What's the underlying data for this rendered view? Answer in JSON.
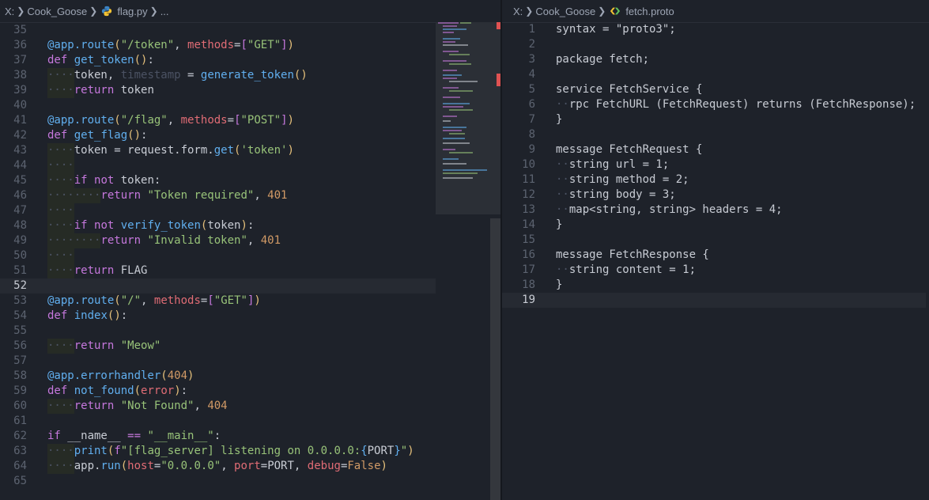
{
  "left_pane": {
    "breadcrumb": {
      "drive": "X:",
      "folder": "Cook_Goose",
      "file": "flag.py",
      "more": "..."
    },
    "active_line": 52,
    "lines": [
      {
        "n": "35",
        "html": ""
      },
      {
        "n": "36",
        "html": "<span class='dec'>@app.route</span><span class='p1'>(</span><span class='str'>\"/token\"</span>, <span class='param'>methods</span>=<span class='p2'>[</span><span class='str'>\"GET\"</span><span class='p2'>]</span><span class='p1'>)</span>"
      },
      {
        "n": "37",
        "html": "<span class='kw'>def</span> <span class='fn'>get_token</span><span class='p1'>()</span>:"
      },
      {
        "n": "38",
        "html": "<span class='ig'>····</span>token, <span class='gr'>timestamp</span> = <span class='fn'>generate_token</span><span class='p1'>()</span>"
      },
      {
        "n": "39",
        "html": "<span class='ig'>····</span><span class='kw'>return</span> token"
      },
      {
        "n": "40",
        "html": ""
      },
      {
        "n": "41",
        "html": "<span class='dec'>@app.route</span><span class='p1'>(</span><span class='str'>\"/flag\"</span>, <span class='param'>methods</span>=<span class='p2'>[</span><span class='str'>\"POST\"</span><span class='p2'>]</span><span class='p1'>)</span>"
      },
      {
        "n": "42",
        "html": "<span class='kw'>def</span> <span class='fn'>get_flag</span><span class='p1'>()</span>:"
      },
      {
        "n": "43",
        "html": "<span class='ig'>····</span>token = request.form.<span class='fn'>get</span><span class='p1'>(</span><span class='str'>'token'</span><span class='p1'>)</span>"
      },
      {
        "n": "44",
        "html": "<span class='ig'>····</span>"
      },
      {
        "n": "45",
        "html": "<span class='ig'>····</span><span class='kw'>if</span> <span class='kw'>not</span> token:"
      },
      {
        "n": "46",
        "html": "<span class='ig'>····</span><span class='ig'>····</span><span class='kw'>return</span> <span class='str'>\"Token required\"</span>, <span class='num'>401</span>"
      },
      {
        "n": "47",
        "html": "<span class='ig'>····</span>"
      },
      {
        "n": "48",
        "html": "<span class='ig'>····</span><span class='kw'>if</span> <span class='kw'>not</span> <span class='fn'>verify_token</span><span class='p1'>(</span>token<span class='p1'>)</span>:"
      },
      {
        "n": "49",
        "html": "<span class='ig'>····</span><span class='ig'>····</span><span class='kw'>return</span> <span class='str'>\"Invalid token\"</span>, <span class='num'>401</span>"
      },
      {
        "n": "50",
        "html": "<span class='ig'>····</span>"
      },
      {
        "n": "51",
        "html": "<span class='ig'>····</span><span class='kw'>return</span> FLAG"
      },
      {
        "n": "52",
        "html": ""
      },
      {
        "n": "53",
        "html": "<span class='dec'>@app.route</span><span class='p1'>(</span><span class='str'>\"/\"</span>, <span class='param'>methods</span>=<span class='p2'>[</span><span class='str'>\"GET\"</span><span class='p2'>]</span><span class='p1'>)</span>"
      },
      {
        "n": "54",
        "html": "<span class='kw'>def</span> <span class='fn'>index</span><span class='p1'>()</span>:"
      },
      {
        "n": "55",
        "html": ""
      },
      {
        "n": "56",
        "html": "<span class='ig'>····</span><span class='kw'>return</span> <span class='str'>\"Meow\"</span>"
      },
      {
        "n": "57",
        "html": ""
      },
      {
        "n": "58",
        "html": "<span class='dec'>@app.errorhandler</span><span class='p1'>(</span><span class='num'>404</span><span class='p1'>)</span>"
      },
      {
        "n": "59",
        "html": "<span class='kw'>def</span> <span class='fn'>not_found</span><span class='p1'>(</span><span class='param'>error</span><span class='p1'>)</span>:"
      },
      {
        "n": "60",
        "html": "<span class='ig'>····</span><span class='kw'>return</span> <span class='str'>\"Not Found\"</span>, <span class='num'>404</span>"
      },
      {
        "n": "61",
        "html": ""
      },
      {
        "n": "62",
        "html": "<span class='kw'>if</span> __name__ <span class='kw'>==</span> <span class='str'>\"__main__\"</span>:"
      },
      {
        "n": "63",
        "html": "<span class='ig'>····</span><span class='fn'>print</span><span class='p1'>(</span><span class='kw'>f</span><span class='str'>\"[flag_server] listening on 0.0.0.0:</span><span class='p3'>{</span>PORT<span class='p3'>}</span><span class='str'>\"</span><span class='p1'>)</span>"
      },
      {
        "n": "64",
        "html": "<span class='ig'>····</span>app.<span class='fn'>run</span><span class='p1'>(</span><span class='param'>host</span>=<span class='str'>\"0.0.0.0\"</span>, <span class='param'>port</span>=PORT, <span class='param'>debug</span>=<span class='num'>False</span><span class='p1'>)</span>"
      },
      {
        "n": "65",
        "html": ""
      }
    ]
  },
  "right_pane": {
    "breadcrumb": {
      "drive": "X:",
      "folder": "Cook_Goose",
      "file": "fetch.proto"
    },
    "active_line": 19,
    "lines": [
      {
        "n": "1",
        "html": "syntax = \"proto3\";"
      },
      {
        "n": "2",
        "html": ""
      },
      {
        "n": "3",
        "html": "package fetch;"
      },
      {
        "n": "4",
        "html": ""
      },
      {
        "n": "5",
        "html": "service FetchService {"
      },
      {
        "n": "6",
        "html": "<span class='ws'>··</span>rpc FetchURL (FetchRequest) returns (FetchResponse);"
      },
      {
        "n": "7",
        "html": "}"
      },
      {
        "n": "8",
        "html": ""
      },
      {
        "n": "9",
        "html": "message FetchRequest {"
      },
      {
        "n": "10",
        "html": "<span class='ws'>··</span>string url = 1;"
      },
      {
        "n": "11",
        "html": "<span class='ws'>··</span>string method = 2;"
      },
      {
        "n": "12",
        "html": "<span class='ws'>··</span>string body = 3;"
      },
      {
        "n": "13",
        "html": "<span class='ws'>··</span>map&lt;string, string&gt; headers = 4;"
      },
      {
        "n": "14",
        "html": "}"
      },
      {
        "n": "15",
        "html": ""
      },
      {
        "n": "16",
        "html": "message FetchResponse {"
      },
      {
        "n": "17",
        "html": "<span class='ws'>··</span>string content = 1;"
      },
      {
        "n": "18",
        "html": "}"
      },
      {
        "n": "19",
        "html": ""
      }
    ]
  },
  "colors": {
    "background": "#1e222a",
    "keyword": "#c678dd",
    "function": "#61afef",
    "string": "#98c379",
    "number": "#d19a66",
    "error_marker": "#e05252"
  }
}
